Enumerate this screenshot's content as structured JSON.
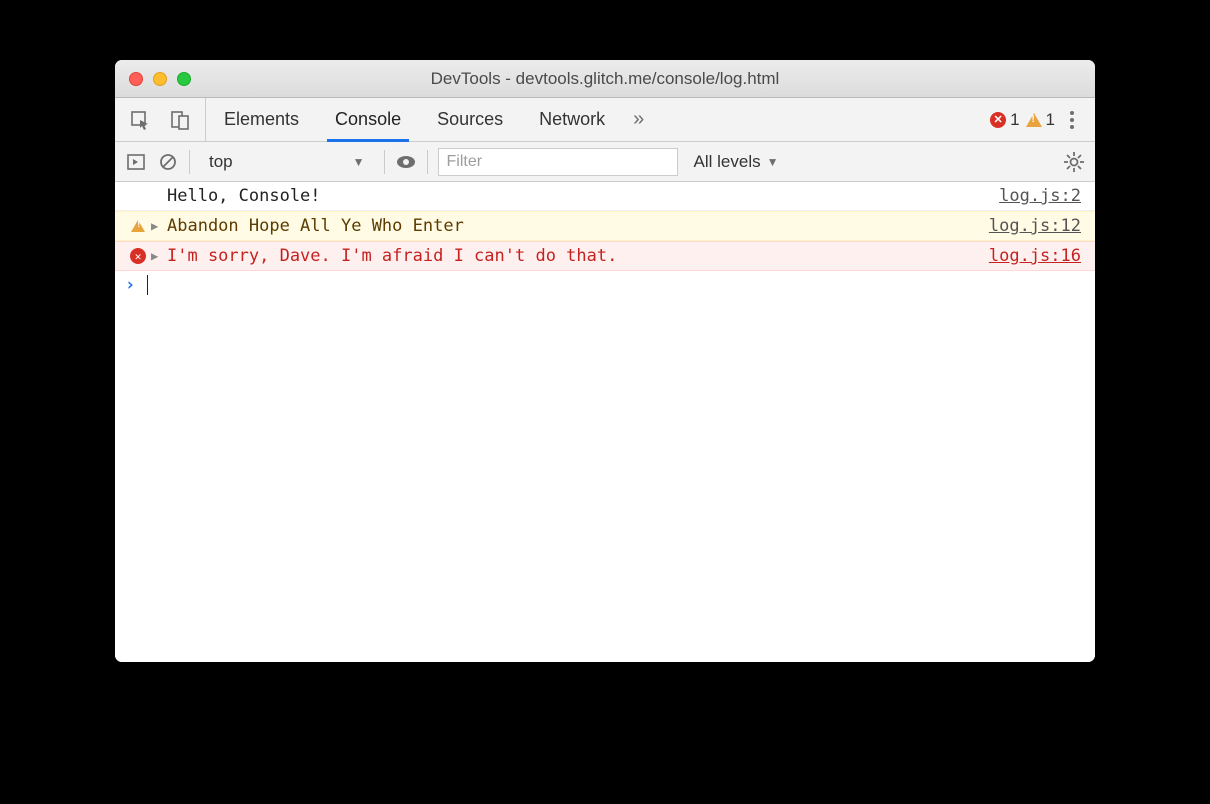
{
  "window": {
    "title": "DevTools - devtools.glitch.me/console/log.html"
  },
  "tabs": {
    "items": [
      "Elements",
      "Console",
      "Sources",
      "Network"
    ],
    "active_index": 1,
    "overflow_glyph": "»"
  },
  "status": {
    "error_count": "1",
    "warning_count": "1"
  },
  "toolbar": {
    "context": "top",
    "filter_placeholder": "Filter",
    "levels_label": "All levels"
  },
  "console": {
    "rows": [
      {
        "type": "log",
        "message": "Hello, Console!",
        "source": "log.js:2"
      },
      {
        "type": "warn",
        "message": "Abandon Hope All Ye Who Enter",
        "source": "log.js:12"
      },
      {
        "type": "error",
        "message": "I'm sorry, Dave. I'm afraid I can't do that.",
        "source": "log.js:16"
      }
    ],
    "prompt_glyph": "›"
  }
}
